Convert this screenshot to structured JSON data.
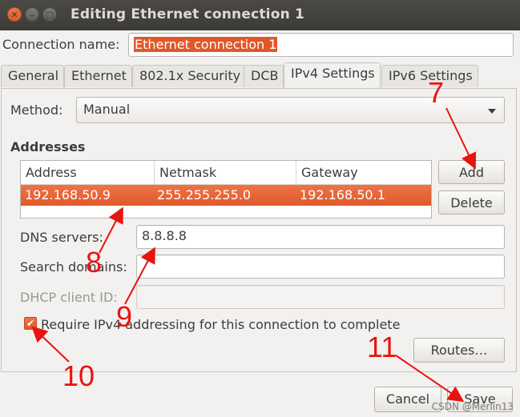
{
  "window": {
    "title": "Editing Ethernet connection 1",
    "close_glyph": "✕",
    "min_glyph": "–",
    "max_glyph": "□"
  },
  "connection": {
    "label": "Connection name:",
    "value": "Ethernet connection 1"
  },
  "tabs": [
    {
      "label": "General"
    },
    {
      "label": "Ethernet"
    },
    {
      "label": "802.1x Security"
    },
    {
      "label": "DCB"
    },
    {
      "label": "IPv4 Settings",
      "active": true
    },
    {
      "label": "IPv6 Settings"
    }
  ],
  "method": {
    "label": "Method:",
    "value": "Manual"
  },
  "addresses": {
    "heading": "Addresses",
    "columns": [
      "Address",
      "Netmask",
      "Gateway"
    ],
    "rows": [
      [
        "192.168.50.9",
        "255.255.255.0",
        "192.168.50.1"
      ]
    ],
    "add_label": "Add",
    "delete_label": "Delete"
  },
  "dns": {
    "label": "DNS servers:",
    "value": "8.8.8.8"
  },
  "search": {
    "label": "Search domains:",
    "value": ""
  },
  "dhcp": {
    "label": "DHCP client ID:",
    "value": ""
  },
  "require": {
    "label": "Require IPv4 addressing for this connection to complete",
    "checked": true
  },
  "routes_label": "Routes…",
  "footer": {
    "cancel_label": "Cancel",
    "save_label": "Save"
  },
  "annotations": [
    "7",
    "8",
    "9",
    "10",
    "11"
  ],
  "watermark": "CSDN @Merlin13",
  "colors": {
    "accent": "#e05828",
    "annotation": "#e8140f",
    "titlebar": "#3c3b37"
  }
}
